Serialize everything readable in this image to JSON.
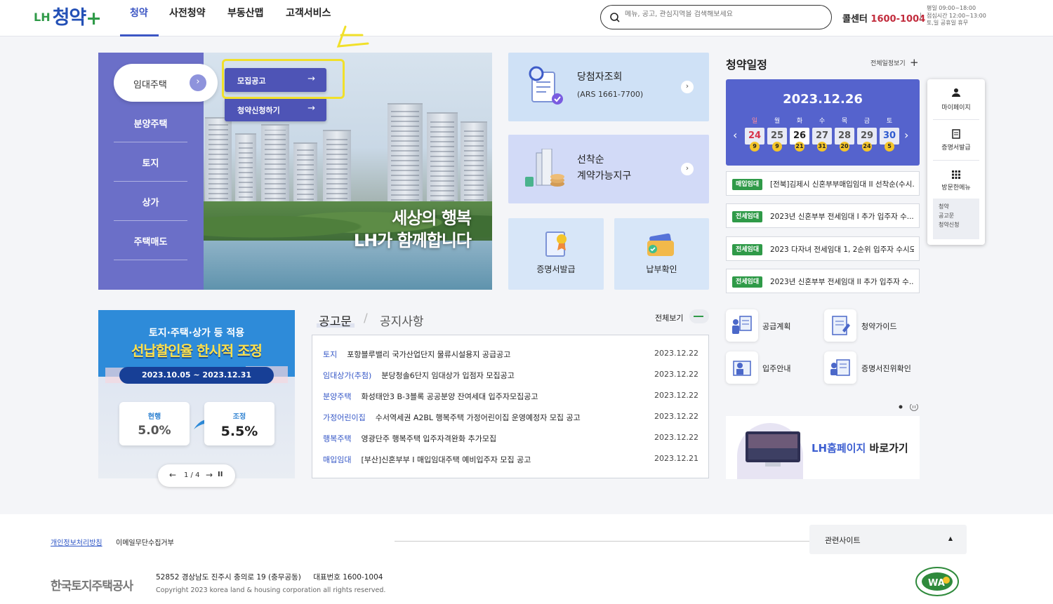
{
  "header": {
    "logo_prefix": "LH",
    "logo_main": "청약",
    "logo_plus": "+",
    "nav": [
      "청약",
      "사전청약",
      "부동산맵",
      "고객서비스"
    ],
    "search_placeholder": "메뉴, 공고, 관심지역을 검색해보세요",
    "call_center_label": "콜센터",
    "call_center_number": "1600-1004",
    "hours": [
      "평일 09:00~18:00",
      "점심시간 12:00~13:00",
      "토,일 공휴일 휴무"
    ]
  },
  "left_menu": {
    "tabs": [
      "임대주택",
      "분양주택",
      "토지",
      "상가",
      "주택매도"
    ],
    "sub_buttons": [
      "모집공고",
      "청약신청하기"
    ],
    "hero_line1": "세상의 행복",
    "hero_line2": "LH가 함께합니다"
  },
  "cards": {
    "winner_title": "당첨자조회",
    "winner_sub": "(ARS 1661-7700)",
    "first_come_line1": "선착순",
    "first_come_line2": "계약가능지구",
    "certificate": "증명서발급",
    "payment": "납부확인"
  },
  "schedule": {
    "title": "청약일정",
    "view_all": "전체일정보기",
    "date": "2023.12.26",
    "weekdays": [
      "일",
      "월",
      "화",
      "수",
      "목",
      "금",
      "토"
    ],
    "days": [
      "24",
      "25",
      "26",
      "27",
      "28",
      "29",
      "30"
    ],
    "counts": [
      "9",
      "9",
      "21",
      "31",
      "20",
      "24",
      "5"
    ],
    "notices": [
      {
        "badge": "매입임대",
        "text": "[전북]김제시 신혼부부매입임대 II  선착순(수시..."
      },
      {
        "badge": "전세임대",
        "text": "2023년 신혼부부 전세임대 I  추가 입주자 수..."
      },
      {
        "badge": "전세임대",
        "text": "2023 다자녀 전세임대 1, 2순위 입주자 수시모..."
      },
      {
        "badge": "전세임대",
        "text": "2023년 신혼부부 전세임대 II  추가 입주자 수..."
      }
    ]
  },
  "quick_panel": {
    "items": [
      "마이페이지",
      "증명서발급",
      "방문한메뉴"
    ],
    "visited": [
      "청약",
      "공고문",
      "청약신청"
    ]
  },
  "promo": {
    "title1": "토지·주택·상가 등 적용",
    "title2": "선납할인율 한시적 조정",
    "date_range": "2023.10.05 ~ 2023.12.31",
    "current_label": "현행",
    "current_value": "5.0%",
    "adjusted_label": "조정",
    "adjusted_value": "5.5%",
    "pager": "1 / 4"
  },
  "announcements": {
    "tab_active": "공고문",
    "separator": "/",
    "tab_inactive": "공지사항",
    "view_all": "전체보기",
    "rows": [
      {
        "category": "토지",
        "title": "포항블루밸리 국가산업단지 물류시설용지 공급공고",
        "date": "2023.12.22"
      },
      {
        "category": "임대상가(추첨)",
        "title": "분당청솔6단지 임대상가 입점자 모집공고",
        "date": "2023.12.22"
      },
      {
        "category": "분양주택",
        "title": "화성태안3 B-3블록 공공분양 잔여세대 입주자모집공고",
        "date": "2023.12.22"
      },
      {
        "category": "가정어린이집",
        "title": "수서역세권 A2BL 행복주택 가정어린이집 운영예정자 모집 공고",
        "date": "2023.12.22"
      },
      {
        "category": "행복주택",
        "title": "영광단주 행복주택 입주자격완화 추가모집",
        "date": "2023.12.22"
      },
      {
        "category": "매입임대",
        "title": "[부산]신혼부부 I  매입임대주택 예비입주자 모집 공고",
        "date": "2023.12.21"
      }
    ]
  },
  "quick_links": [
    "공급계획",
    "청약가이드",
    "입주안내",
    "증명서진위확인"
  ],
  "lh_banner": {
    "accent": "LH홈페이지",
    "rest": " 바로가기"
  },
  "footer": {
    "privacy": "개인정보처리방침",
    "email_refusal": "이메일무단수집거부",
    "related_sites": "관련사이트",
    "org": "한국토지주택공사",
    "address": "52852 경상남도 진주시 충의로 19 (충무공동)",
    "rep_label": "대표번호",
    "rep_number": "1600-1004",
    "copyright": "Copyright 2023 korea land & housing corporation all rights reserved.",
    "wa_mark": "WA"
  },
  "colors": {
    "accent": "#3c56c4",
    "menu": "#6b6fc8",
    "calendar": "#5563cd",
    "badge_green": "#2f9a48",
    "highlight": "#f1e02a",
    "sunday": "#d8334a"
  }
}
